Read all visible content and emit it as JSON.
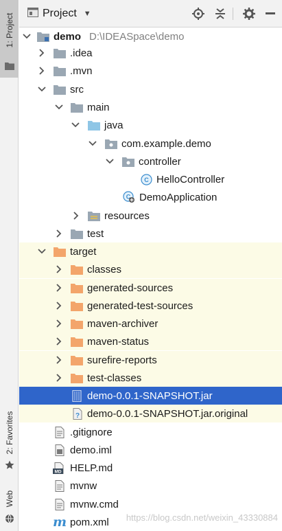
{
  "stripe": {
    "project_tab": "1: Project",
    "favorites_tab": "2: Favorites",
    "web_tab": "Web"
  },
  "header": {
    "title": "Project",
    "icons": [
      "locate-icon",
      "collapse-all-icon",
      "settings-icon",
      "hide-icon"
    ]
  },
  "tree": {
    "root": {
      "name": "demo",
      "path": "D:\\IDEASpace\\demo"
    },
    "idea": ".idea",
    "mvn": ".mvn",
    "src": "src",
    "main": "main",
    "java": "java",
    "package": "com.example.demo",
    "controller": "controller",
    "hello_controller": "HelloController",
    "demo_application": "DemoApplication",
    "resources": "resources",
    "test": "test",
    "target": "target",
    "classes": "classes",
    "generated_sources": "generated-sources",
    "generated_test_sources": "generated-test-sources",
    "maven_archiver": "maven-archiver",
    "maven_status": "maven-status",
    "surefire_reports": "surefire-reports",
    "test_classes": "test-classes",
    "jar": "demo-0.0.1-SNAPSHOT.jar",
    "jar_original": "demo-0.0.1-SNAPSHOT.jar.original",
    "gitignore": ".gitignore",
    "iml": "demo.iml",
    "help": "HELP.md",
    "mvnw": "mvnw",
    "mvnw_cmd": "mvnw.cmd",
    "pom": "pom.xml"
  },
  "watermark": "https://blog.csdn.net/weixin_43330884",
  "colors": {
    "selection": "#2f65ca",
    "excluded_bg": "#fcfbe6",
    "folder": "#9aa7b3",
    "source_folder": "#8fc6e6",
    "excluded_folder": "#f3a56b"
  }
}
